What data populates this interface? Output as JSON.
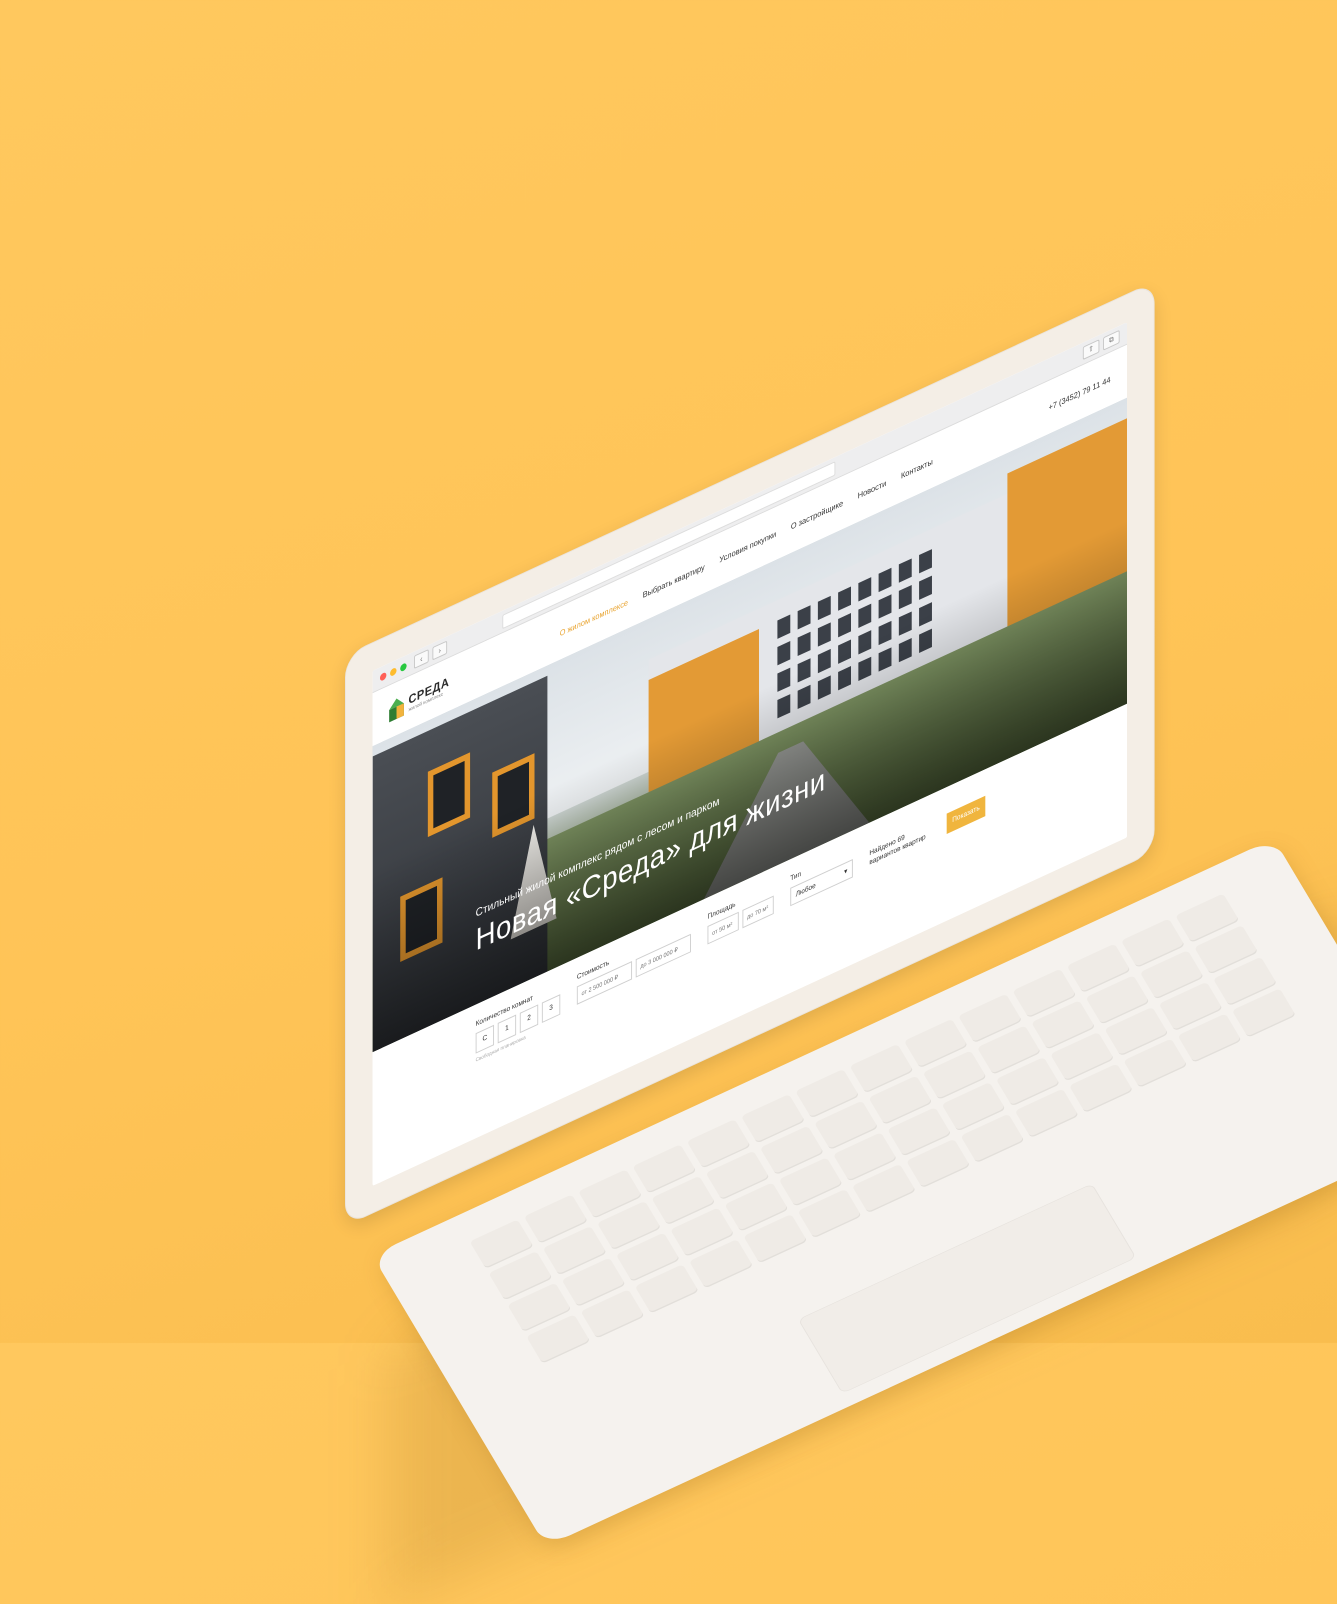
{
  "browser": {
    "back_label": "‹",
    "forward_label": "›",
    "share_label": "⇧",
    "tabs_label": "⧉"
  },
  "site": {
    "logo": {
      "title": "СРЕДА",
      "subtitle": "жилой комплекс"
    },
    "nav": [
      {
        "label": "О жилом комплексе",
        "active": true
      },
      {
        "label": "Выбрать квартиру",
        "active": false
      },
      {
        "label": "Условия покупки",
        "active": false
      },
      {
        "label": "О застройщике",
        "active": false
      },
      {
        "label": "Новости",
        "active": false
      },
      {
        "label": "Контакты",
        "active": false
      }
    ],
    "phone": "+7 (3452) 79 11 44"
  },
  "hero": {
    "subtitle": "Стильный жилой комплекс рядом с лесом и парком",
    "title": "Новая «Среда» для жизни"
  },
  "filters": {
    "rooms": {
      "label": "Количество комнат",
      "options": [
        "С",
        "1",
        "2",
        "3"
      ],
      "hint": "Свободная планировка"
    },
    "price": {
      "label": "Стоимость",
      "from": "от 2 500 000 ₽",
      "to": "до 3 000 000 ₽"
    },
    "area": {
      "label": "Площадь",
      "from": "от 50 м²",
      "to": "до 70 м²"
    },
    "type": {
      "label": "Тип",
      "value": "Любое",
      "chevron": "▾"
    },
    "found": "Найдено 69 вариантов квартир",
    "show_button": "Показать"
  },
  "colors": {
    "background": "#FFC457",
    "accent": "#F0B53E",
    "nav_active": "#E9A430",
    "laptop": "#F4EEE6"
  }
}
